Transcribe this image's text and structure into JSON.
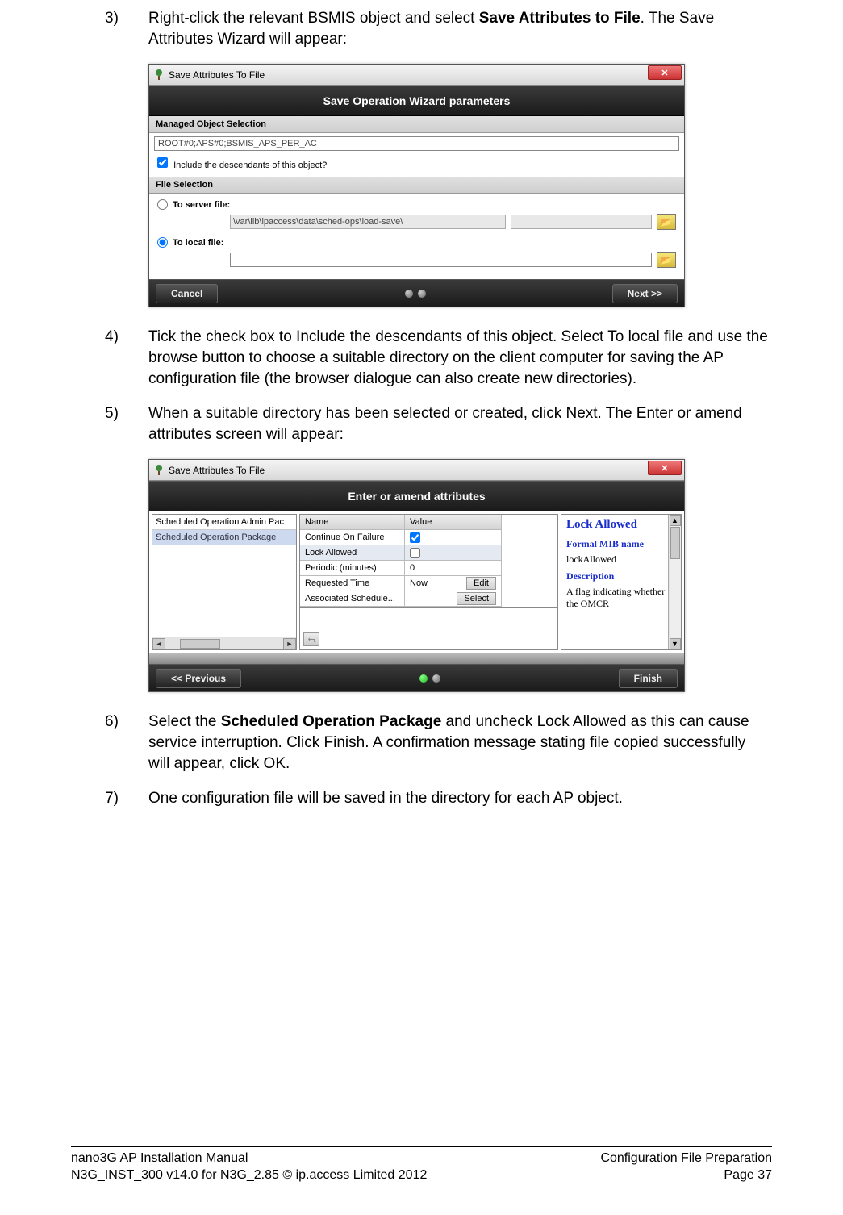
{
  "steps": {
    "3": {
      "num": "3)",
      "prefix": "Right-click the relevant BSMIS object and select ",
      "bold": "Save Attributes to File",
      "suffix": ". The Save Attributes Wizard will appear:"
    },
    "4": {
      "num": "4)",
      "text": "Tick the check box to Include the descendants of this object. Select To local file and use the browse button to choose a suitable directory on the client computer for saving the AP configuration file (the browser dialogue can also create new directories)."
    },
    "5": {
      "num": "5)",
      "text": " When a suitable directory has been selected or created, click Next. The Enter or amend attributes screen will appear:"
    },
    "6": {
      "num": "6)",
      "prefix": "Select the ",
      "bold": "Scheduled Operation Package",
      "suffix": " and uncheck Lock Allowed as this can cause service interruption. Click Finish. A confirmation message stating file copied successfully will appear, click OK."
    },
    "7": {
      "num": "7)",
      "text": "One configuration file will be saved in the directory for each AP object."
    }
  },
  "dialog1": {
    "title": "Save Attributes To File",
    "header": "Save Operation Wizard parameters",
    "section1": "Managed Object Selection",
    "object_selection": "ROOT#0;APS#0;BSMIS_APS_PER_AC",
    "include_checkbox_label": "Include the descendants of this object?",
    "section2": "File Selection",
    "server_file_label": "To server file:",
    "server_file_value": "\\var\\lib\\ipaccess\\data\\sched-ops\\load-save\\",
    "local_file_label": "To local file:",
    "local_file_value": "",
    "cancel": "Cancel",
    "next": "Next >>"
  },
  "dialog2": {
    "title": "Save Attributes To File",
    "header": "Enter or amend attributes",
    "left_items": [
      "Scheduled Operation Admin Pac",
      "Scheduled Operation Package"
    ],
    "col_name": "Name",
    "col_value": "Value",
    "rows": [
      {
        "name": "Continue On Failure",
        "value_check": true
      },
      {
        "name": "Lock Allowed",
        "value_nocheck": true,
        "sel": true
      },
      {
        "name": "Periodic (minutes)",
        "value": "0"
      },
      {
        "name": "Requested Time",
        "value": "Now",
        "btn": "Edit"
      },
      {
        "name": "Associated Schedule...",
        "value": "",
        "btn": "Select"
      }
    ],
    "right": {
      "title": "Lock Allowed",
      "sub1": "Formal MIB name",
      "val1": "lockAllowed",
      "sub2": "Description",
      "val2": "A flag indicating whether the OMCR"
    },
    "prev": "<< Previous",
    "finish": "Finish"
  },
  "footer": {
    "l1": "nano3G AP Installation Manual",
    "l2": "N3G_INST_300 v14.0 for N3G_2.85 © ip.access Limited 2012",
    "r1": "Configuration File Preparation",
    "r2": "Page 37"
  }
}
